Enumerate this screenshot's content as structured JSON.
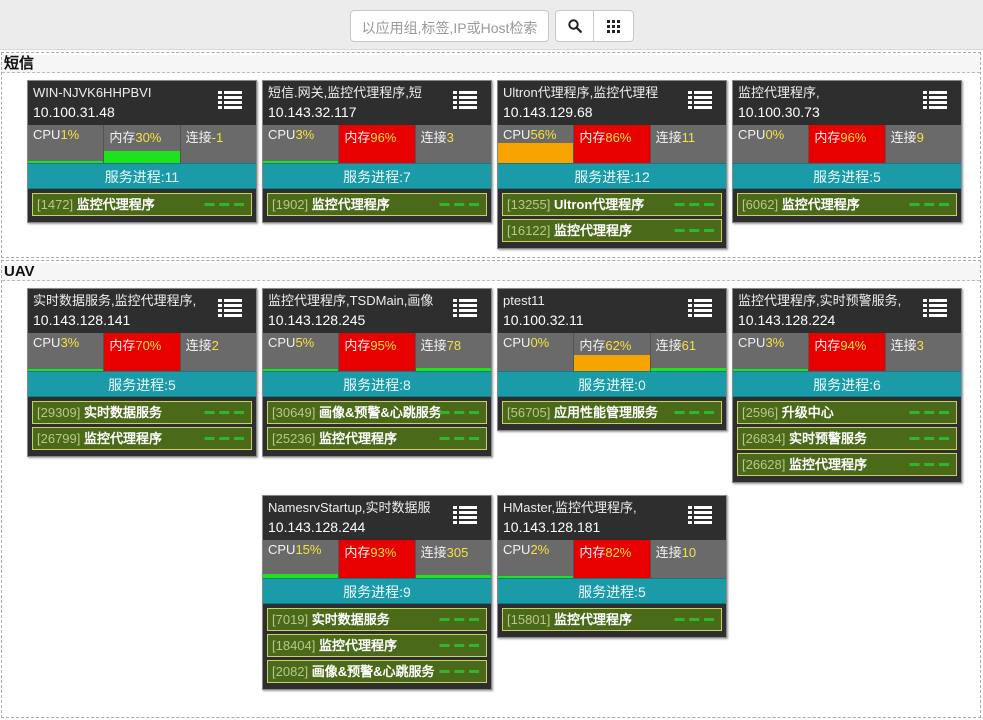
{
  "search": {
    "placeholder": "以应用组,标签,IP或Host检索"
  },
  "groups": [
    {
      "name": "短信",
      "hosts": [
        {
          "title": "WIN-NJVK6HHPBVI",
          "ip": "10.100.31.48",
          "cpu": "1%",
          "mem": "30%",
          "conn": "-1",
          "cpu_level": 0.01,
          "mem_level": 0.3,
          "conn_level": 0,
          "mem_color": "green",
          "services": "服务进程:11",
          "procs": [
            {
              "pid": "[1472]",
              "name": "监控代理程序"
            }
          ]
        },
        {
          "title": "短信.网关,监控代理程序,短",
          "ip": "10.143.32.117",
          "cpu": "3%",
          "mem": "96%",
          "conn": "3",
          "cpu_level": 0.03,
          "mem_level": 0.96,
          "conn_level": 0,
          "mem_color": "red",
          "services": "服务进程:7",
          "procs": [
            {
              "pid": "[1902]",
              "name": "监控代理程序"
            }
          ]
        },
        {
          "title": "Ultron代理程序,监控代理程",
          "ip": "10.143.129.68",
          "cpu": "56%",
          "mem": "86%",
          "conn": "11",
          "cpu_level": 0.56,
          "mem_level": 0.86,
          "conn_level": 0,
          "mem_color": "red",
          "cpu_color": "orange",
          "services": "服务进程:12",
          "procs": [
            {
              "pid": "[13255]",
              "name": "Ultron代理程序"
            },
            {
              "pid": "[16122]",
              "name": "监控代理程序"
            }
          ]
        },
        {
          "title": "监控代理程序,",
          "ip": "10.100.30.73",
          "cpu": "0%",
          "mem": "96%",
          "conn": "9",
          "cpu_level": 0,
          "mem_level": 0.96,
          "conn_level": 0,
          "mem_color": "red",
          "services": "服务进程:5",
          "procs": [
            {
              "pid": "[6062]",
              "name": "监控代理程序"
            }
          ]
        }
      ]
    },
    {
      "name": "UAV",
      "hosts": [
        {
          "title": "实时数据服务,监控代理程序,",
          "ip": "10.143.128.141",
          "cpu": "3%",
          "mem": "70%",
          "conn": "2",
          "mem_color": "red",
          "services": "服务进程:5",
          "procs": [
            {
              "pid": "[29309]",
              "name": "实时数据服务"
            },
            {
              "pid": "[26799]",
              "name": "监控代理程序"
            }
          ]
        },
        {
          "title": "监控代理程序,TSDMain,画像",
          "ip": "10.143.128.245",
          "cpu": "5%",
          "mem": "95%",
          "conn": "78",
          "mem_color": "red",
          "services": "服务进程:8",
          "procs": [
            {
              "pid": "[30649]",
              "name": "画像&预警&心跳服务"
            },
            {
              "pid": "[25236]",
              "name": "监控代理程序"
            }
          ]
        },
        {
          "title": "ptest11",
          "ip": "10.100.32.11",
          "cpu": "0%",
          "mem": "62%",
          "conn": "61",
          "mem_color": "orange",
          "services": "服务进程:0",
          "procs": [
            {
              "pid": "[56705]",
              "name": "应用性能管理服务"
            }
          ]
        },
        {
          "title": "监控代理程序,实时预警服务,",
          "ip": "10.143.128.224",
          "cpu": "3%",
          "mem": "94%",
          "conn": "3",
          "mem_color": "red",
          "services": "服务进程:6",
          "procs": [
            {
              "pid": "[2596]",
              "name": "升级中心"
            },
            {
              "pid": "[26834]",
              "name": "实时预警服务"
            },
            {
              "pid": "[26628]",
              "name": "监控代理程序"
            }
          ]
        },
        {
          "title": "NamesrvStartup,实时数据服",
          "ip": "10.143.128.244",
          "cpu": "15%",
          "mem": "93%",
          "conn": "305",
          "mem_color": "red",
          "services": "服务进程:9",
          "procs": [
            {
              "pid": "[7019]",
              "name": "实时数据服务"
            },
            {
              "pid": "[18404]",
              "name": "监控代理程序"
            },
            {
              "pid": "[2082]",
              "name": "画像&预警&心跳服务"
            }
          ]
        },
        {
          "title": "HMaster,监控代理程序,",
          "ip": "10.143.128.181",
          "cpu": "2%",
          "mem": "82%",
          "conn": "10",
          "mem_color": "red",
          "services": "服务进程:5",
          "procs": [
            {
              "pid": "[15801]",
              "name": "监控代理程序"
            }
          ]
        }
      ]
    }
  ],
  "labels": {
    "cpu": "CPU",
    "mem": "内存",
    "conn": "连接"
  },
  "colors": {
    "red": "#e80000",
    "orange": "#f7a300",
    "green": "#1de21d",
    "service_bar": "#1b9aa8",
    "proc_bg": "#4a6a1a"
  },
  "icons": {
    "search": "search-icon",
    "grid": "grid-icon",
    "menu": "list-menu-icon"
  }
}
